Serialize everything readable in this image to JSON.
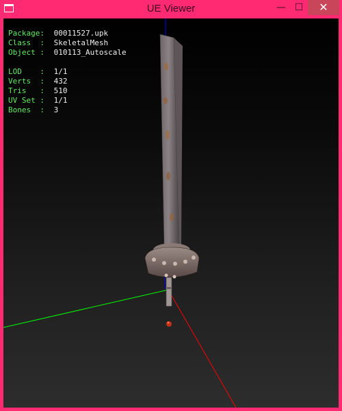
{
  "window": {
    "title": "UE Viewer",
    "close_glyph": "✕",
    "minimize_glyph": "—",
    "maximize_glyph": "☐"
  },
  "stats": {
    "package": {
      "label": "Package:",
      "value": "00011527.upk"
    },
    "class": {
      "label": "Class  :",
      "value": "SkeletalMesh"
    },
    "object": {
      "label": "Object :",
      "value": "010113_Autoscale"
    },
    "lod": {
      "label": "LOD    :",
      "value": "1/1"
    },
    "verts": {
      "label": "Verts  :",
      "value": "432"
    },
    "tris": {
      "label": "Tris   :",
      "value": "510"
    },
    "uvset": {
      "label": "UV Set :",
      "value": "1/1"
    },
    "bones": {
      "label": "Bones  :",
      "value": "3"
    }
  },
  "colors": {
    "titlebar": "#ff2a72",
    "stats_label": "#60ee60",
    "axis_x": "#ff0000",
    "axis_y": "#00ff00",
    "axis_z": "#0000ff"
  }
}
